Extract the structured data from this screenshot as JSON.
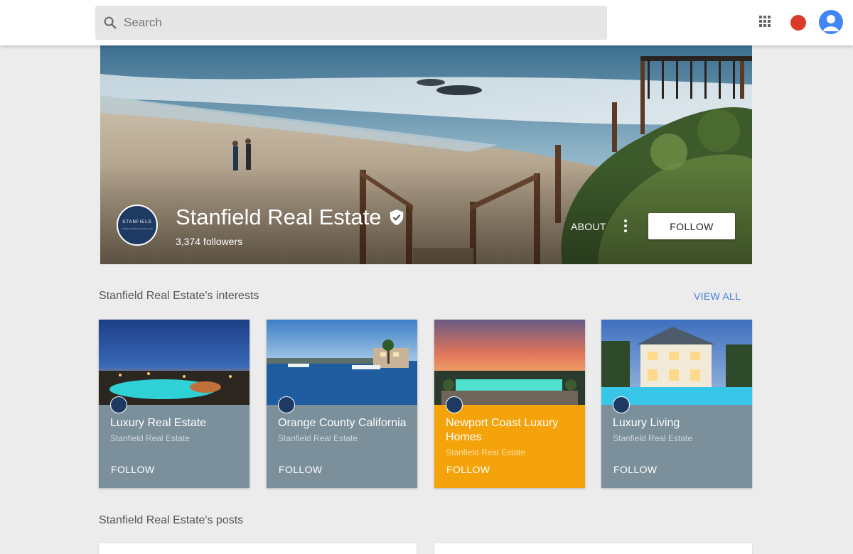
{
  "search": {
    "placeholder": "Search",
    "icon": "search-icon"
  },
  "header": {
    "apps_icon": "apps-grid-icon",
    "notification_color": "#db3b2a",
    "avatar_color": "#4285f4"
  },
  "profile": {
    "name": "Stanfield Real Estate",
    "verified": true,
    "followers": "3,374 followers",
    "about_label": "ABOUT",
    "follow_label": "FOLLOW",
    "logo_text": "STANFIELD",
    "logo_subtext": "STANFIELDREALESTATE.COM"
  },
  "interests": {
    "title": "Stanfield Real Estate's interests",
    "view_all_label": "VIEW ALL",
    "cards": [
      {
        "title": "Luxury Real Estate",
        "subtitle": "Stanfield Real Estate",
        "follow_label": "FOLLOW",
        "highlighted": false
      },
      {
        "title": "Orange County California",
        "subtitle": "Stanfield Real Estate",
        "follow_label": "FOLLOW",
        "highlighted": false
      },
      {
        "title": "Newport Coast Luxury Homes",
        "subtitle": "Stanfield Real Estate",
        "follow_label": "FOLLOW",
        "highlighted": true
      },
      {
        "title": "Luxury Living",
        "subtitle": "Stanfield Real Estate",
        "follow_label": "FOLLOW",
        "highlighted": false
      }
    ]
  },
  "posts": {
    "title": "Stanfield Real Estate's posts"
  },
  "colors": {
    "accent": "#3f7fd6",
    "card_default": "#7b909b",
    "card_highlight": "#f5a30a",
    "brand_navy": "#1e3a63"
  }
}
